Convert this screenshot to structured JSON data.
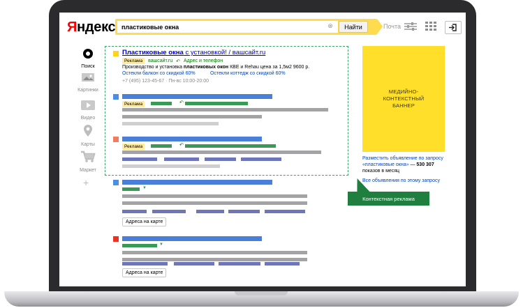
{
  "header": {
    "logo_first": "Я",
    "logo_rest": "ндекс",
    "search_value": "пластиковые окна",
    "search_button": "Найти",
    "mail": "Почта"
  },
  "nav": {
    "items": [
      {
        "label": "Поиск",
        "icon": "search-icon"
      },
      {
        "label": "Картинки",
        "icon": "images-icon"
      },
      {
        "label": "Видео",
        "icon": "video-icon"
      },
      {
        "label": "Карты",
        "icon": "map-pin-icon"
      },
      {
        "label": "Маркет",
        "icon": "cart-icon"
      }
    ],
    "more": "+"
  },
  "ad": {
    "title_bold": "Пластиковые окна",
    "title_rest": " с установкой! / вашсайт.ru",
    "badge": "Реклама",
    "domain": "вашсайт.ru",
    "address_link": "Адрес и телефон",
    "desc_1": "Производство и установка ",
    "desc_bold": "пластиковых окон",
    "desc_2": " КВЕ и Rehau цена за 1,5м2 9600 р.",
    "sitelink_1": "Остекли балкон со скидкой 60%",
    "sitelink_2": "Остекли коттедж со скидкой 60%",
    "contact": "+7 (495) 123-45-67 · Пн-вс 10:00-20:00"
  },
  "placeholders": {
    "badge": "Реклама",
    "map_button": "Адреса на карте"
  },
  "right": {
    "banner": "МЕДИЙНО-КОНТЕКСТНЫЙ БАННЕР",
    "place_ad": "Разместить объявление по запросу «пластиковые окна»",
    "dash": " — ",
    "count": "530 307",
    "count_tail": " показов в месяц",
    "all_ads": "Все объявления по этому запросу",
    "tooltip": "Контекстная реклама"
  },
  "colors": {
    "accent": "#ffdb4d",
    "ad_frame": "#3ca06a",
    "tooltip": "#1e7f3f"
  }
}
